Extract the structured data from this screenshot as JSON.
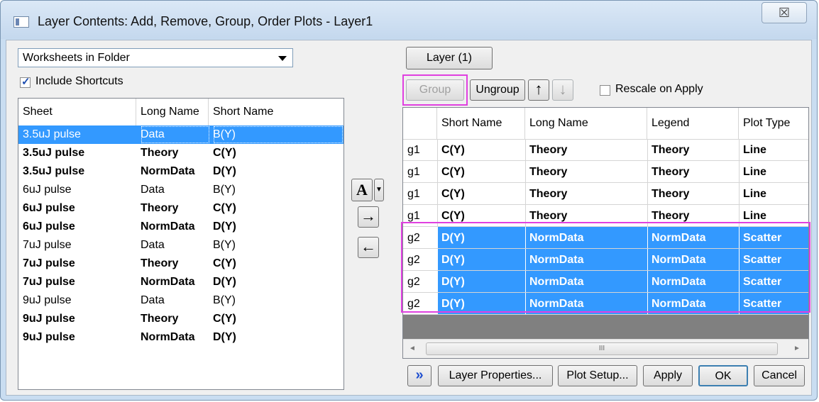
{
  "window": {
    "title": "Layer Contents: Add, Remove, Group, Order Plots - Layer1",
    "close_glyph": "☒"
  },
  "left": {
    "source_dropdown": "Worksheets in Folder",
    "include_shortcuts": {
      "label": "Include Shortcuts",
      "checked": true
    },
    "columns": [
      "Sheet",
      "Long Name",
      "Short Name"
    ],
    "rows": [
      {
        "sheet": "3.5uJ pulse",
        "long": "Data",
        "short": "B(Y)",
        "bold": false,
        "selected": true
      },
      {
        "sheet": "3.5uJ pulse",
        "long": "Theory",
        "short": "C(Y)",
        "bold": true,
        "selected": false
      },
      {
        "sheet": "3.5uJ pulse",
        "long": "NormData",
        "short": "D(Y)",
        "bold": true,
        "selected": false
      },
      {
        "sheet": "6uJ pulse",
        "long": "Data",
        "short": "B(Y)",
        "bold": false,
        "selected": false
      },
      {
        "sheet": "6uJ pulse",
        "long": "Theory",
        "short": "C(Y)",
        "bold": true,
        "selected": false
      },
      {
        "sheet": "6uJ pulse",
        "long": "NormData",
        "short": "D(Y)",
        "bold": true,
        "selected": false
      },
      {
        "sheet": "7uJ pulse",
        "long": "Data",
        "short": "B(Y)",
        "bold": false,
        "selected": false
      },
      {
        "sheet": "7uJ pulse",
        "long": "Theory",
        "short": "C(Y)",
        "bold": true,
        "selected": false
      },
      {
        "sheet": "7uJ pulse",
        "long": "NormData",
        "short": "D(Y)",
        "bold": true,
        "selected": false
      },
      {
        "sheet": "9uJ pulse",
        "long": "Data",
        "short": "B(Y)",
        "bold": false,
        "selected": false
      },
      {
        "sheet": "9uJ pulse",
        "long": "Theory",
        "short": "C(Y)",
        "bold": true,
        "selected": false
      },
      {
        "sheet": "9uJ pulse",
        "long": "NormData",
        "short": "D(Y)",
        "bold": true,
        "selected": false
      }
    ]
  },
  "middle": {
    "font_button": "A",
    "add_arrow": "→",
    "remove_arrow": "←"
  },
  "right": {
    "layer_button": "Layer (1)",
    "group_button": "Group",
    "ungroup_button": "Ungroup",
    "up_arrow": "↑",
    "down_arrow": "↓",
    "rescale": {
      "label": "Rescale on Apply",
      "checked": false
    },
    "columns": [
      "",
      "Short Name",
      "Long Name",
      "Legend",
      "Plot Type"
    ],
    "rows": [
      {
        "group": "g1",
        "short": "C(Y)",
        "long": "Theory",
        "legend": "Theory",
        "type": "Line",
        "selected": false
      },
      {
        "group": "g1",
        "short": "C(Y)",
        "long": "Theory",
        "legend": "Theory",
        "type": "Line",
        "selected": false
      },
      {
        "group": "g1",
        "short": "C(Y)",
        "long": "Theory",
        "legend": "Theory",
        "type": "Line",
        "selected": false
      },
      {
        "group": "g1",
        "short": "C(Y)",
        "long": "Theory",
        "legend": "Theory",
        "type": "Line",
        "selected": false
      },
      {
        "group": "g2",
        "short": "D(Y)",
        "long": "NormData",
        "legend": "NormData",
        "type": "Scatter",
        "selected": true
      },
      {
        "group": "g2",
        "short": "D(Y)",
        "long": "NormData",
        "legend": "NormData",
        "type": "Scatter",
        "selected": true
      },
      {
        "group": "g2",
        "short": "D(Y)",
        "long": "NormData",
        "legend": "NormData",
        "type": "Scatter",
        "selected": true
      },
      {
        "group": "g2",
        "short": "D(Y)",
        "long": "NormData",
        "legend": "NormData",
        "type": "Scatter",
        "selected": true
      }
    ],
    "scroll_thumb_glyph": "III"
  },
  "bottom": {
    "expand_glyph": "»",
    "layer_properties": "Layer Properties...",
    "plot_setup": "Plot Setup...",
    "apply": "Apply",
    "ok": "OK",
    "cancel": "Cancel"
  }
}
